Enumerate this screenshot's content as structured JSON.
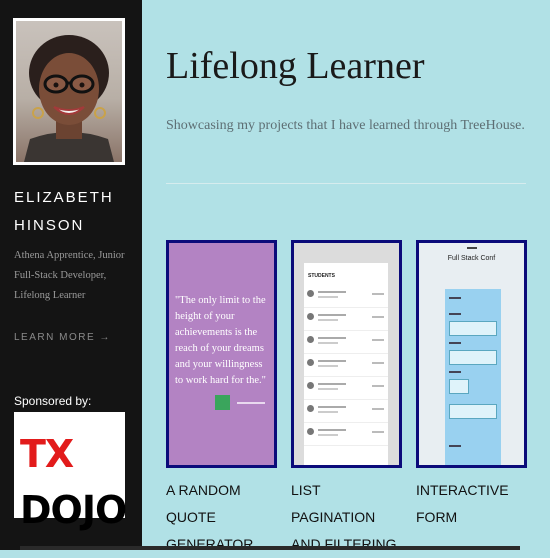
{
  "sidebar": {
    "author_name": "Elizabeth Hinson",
    "author_bio": "Athena Apprentice, Junior Full-Stack Developer, Lifelong Learner",
    "learn_more": "LEARN MORE →",
    "sponsored_label": "Sponsored by:",
    "sponsor_logo_tx": "TX",
    "sponsor_logo_dojo": "DOJO"
  },
  "header": {
    "title": "Lifelong Learner",
    "subtitle": "Showcasing my projects that I have learned through TreeHouse."
  },
  "projects": [
    {
      "label": "A Random Quote Generator",
      "quote": "\"The only limit to the height of your achievements is the reach of your dreams and your willingness to work hard for the.\""
    },
    {
      "label": "List Pagination and Filtering",
      "heading": "STUDENTS"
    },
    {
      "label": "Interactive Form",
      "heading": "Full Stack Conf"
    }
  ],
  "colors": {
    "background": "#b1e1e6",
    "sidebar": "#141414",
    "card_border": "#0b0b7a",
    "quote_card": "#b383c3",
    "form_card": "#99d1f0"
  }
}
